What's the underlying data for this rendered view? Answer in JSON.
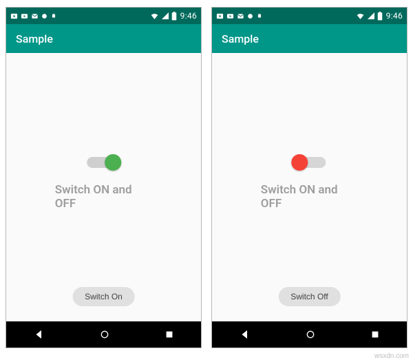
{
  "watermark": "wsxdn.com",
  "screens": [
    {
      "status": {
        "time": "9:46"
      },
      "appbar": {
        "title": "Sample"
      },
      "switch": {
        "state": "on"
      },
      "label": "Switch ON and OFF",
      "button": {
        "label": "Switch On"
      }
    },
    {
      "status": {
        "time": "9:46"
      },
      "appbar": {
        "title": "Sample"
      },
      "switch": {
        "state": "off"
      },
      "label": "Switch ON and OFF",
      "button": {
        "label": "Switch Off"
      }
    }
  ]
}
